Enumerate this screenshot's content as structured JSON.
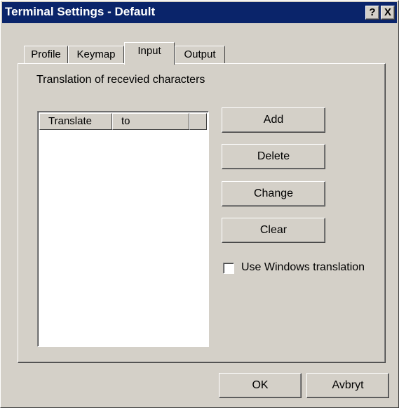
{
  "window": {
    "title": "Terminal Settings - Default",
    "help_button": "?",
    "close_button": "X"
  },
  "tabs": [
    {
      "label": "Profile",
      "active": false
    },
    {
      "label": "Keymap",
      "active": false
    },
    {
      "label": "Input",
      "active": true
    },
    {
      "label": "Output",
      "active": false
    }
  ],
  "input_panel": {
    "caption": "Translation of recevied characters",
    "table": {
      "columns": [
        "Translate",
        "to",
        ""
      ],
      "rows": []
    },
    "buttons": {
      "add": "Add",
      "delete": "Delete",
      "change": "Change",
      "clear": "Clear"
    },
    "use_windows_translation": {
      "label": "Use Windows translation",
      "checked": false
    }
  },
  "footer": {
    "ok_label": "OK",
    "cancel_label": "Avbryt"
  },
  "colors": {
    "title_bar": "#0a246a",
    "face": "#d4d0c8"
  }
}
